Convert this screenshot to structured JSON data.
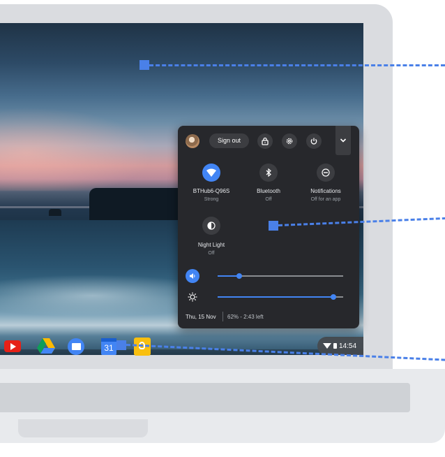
{
  "quick_settings": {
    "sign_out_label": "Sign out",
    "header_icons": [
      "avatar",
      "lock-icon",
      "gear-icon",
      "power-icon",
      "chevron-down-icon"
    ],
    "tiles": [
      {
        "name": "wifi",
        "label": "BTHub6-Q96S",
        "status": "Strong",
        "active": true
      },
      {
        "name": "bluetooth",
        "label": "Bluetooth",
        "status": "Off",
        "active": false
      },
      {
        "name": "notifications",
        "label": "Notifications",
        "status": "Off for an app",
        "active": false
      },
      {
        "name": "night-light",
        "label": "Night Light",
        "status": "Off",
        "active": false
      }
    ],
    "volume_level": 0.17,
    "brightness_level": 0.92,
    "date": "Thu, 15 Nov",
    "battery": "62% - 2:43 left"
  },
  "shelf": {
    "apps": [
      "YouTube",
      "Drive",
      "Files",
      "Calendar",
      "Keep"
    ],
    "calendar_day": "31",
    "time": "14:54"
  },
  "colors": {
    "accent": "#4285f4",
    "panel_bg": "#27282c",
    "callout": "#4a80e8"
  }
}
